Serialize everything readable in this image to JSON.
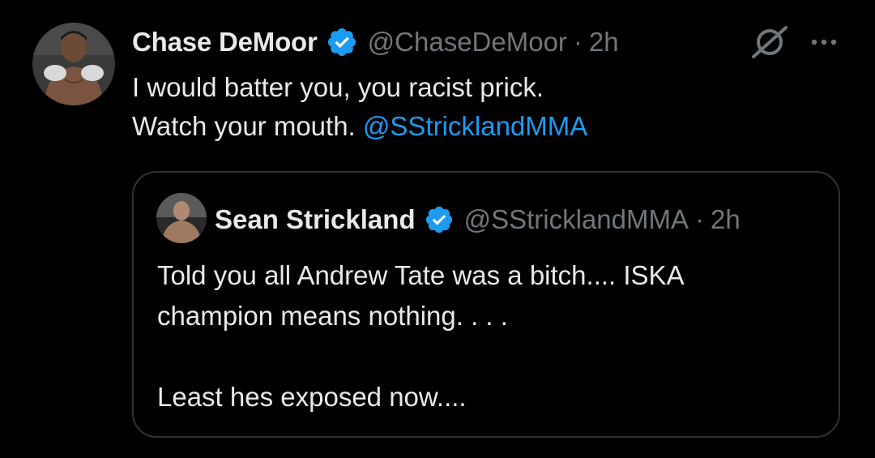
{
  "tweet": {
    "author_name": "Chase DeMoor",
    "handle": "@ChaseDeMoor",
    "separator": "·",
    "time": "2h",
    "text_line1": "I would batter you, you racist prick.",
    "text_line2_prefix": "Watch your mouth. ",
    "mention": "@SStricklandMMA",
    "avatar_icon": "user-avatar-photo",
    "verified_icon": "verified-badge-icon",
    "grok_icon": "grok-icon",
    "more_icon": "more-options-icon"
  },
  "quoted_tweet": {
    "author_name": "Sean Strickland",
    "handle": "@SStricklandMMA",
    "separator": "·",
    "time": "2h",
    "text_line1": "Told you all Andrew Tate was a bitch.... ISKA",
    "text_line2": "champion means nothing. . . .",
    "text_line3": "",
    "text_line4": "Least hes exposed now....",
    "avatar_icon": "user-avatar-photo",
    "verified_icon": "verified-badge-icon"
  },
  "colors": {
    "background": "#000000",
    "text_primary": "#e7e9ea",
    "text_secondary": "#71767b",
    "link": "#1d9bf0",
    "verified": "#1d9bf0",
    "border": "#2f3336"
  }
}
